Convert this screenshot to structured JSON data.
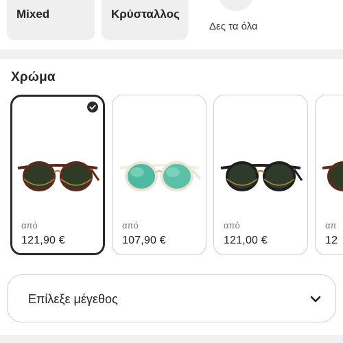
{
  "materials": {
    "items": [
      {
        "label": "Mixed"
      },
      {
        "label": "Κρύσταλλος"
      }
    ],
    "see_all_label": "Δες τα όλα"
  },
  "color_section": {
    "title": "Χρώμα",
    "cards": [
      {
        "from_label": "από",
        "price": "121,90 €",
        "selected": true,
        "frame_color": "#5a2a1c",
        "lens_color": "#2f3b25",
        "accent": "#b08a3e"
      },
      {
        "from_label": "από",
        "price": "107,90 €",
        "selected": false,
        "frame_color": "#f3efe2",
        "lens_color": "#4fb8a0",
        "accent": "#d8c89a"
      },
      {
        "from_label": "από",
        "price": "121,00 €",
        "selected": false,
        "frame_color": "#1f1f1f",
        "lens_color": "#2e3a2a",
        "accent": "#b08a3e"
      },
      {
        "from_label": "απ",
        "price": "12",
        "selected": false,
        "frame_color": "#5a2a1c",
        "lens_color": "#2f3b25",
        "accent": "#b08a3e"
      }
    ]
  },
  "size_select": {
    "label": "Επίλεξε μέγεθος"
  },
  "icons": {
    "selected_check": "check-circle-icon",
    "dropdown": "chevron-down-icon"
  },
  "colors": {
    "selected_border": "#2a2a2a",
    "card_border": "#cfcfcf",
    "chip_background": "#efefef"
  }
}
